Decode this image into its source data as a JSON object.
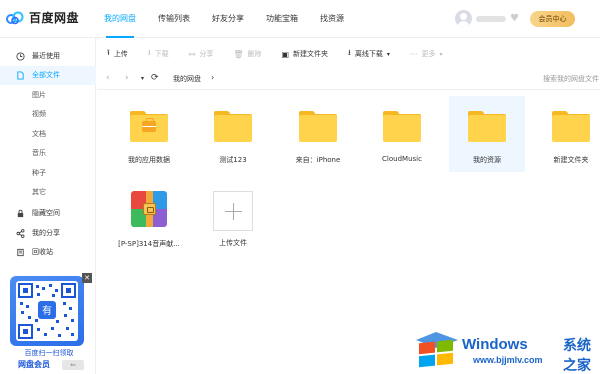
{
  "app": {
    "logo_text": "百度网盘"
  },
  "nav": {
    "tabs": [
      {
        "label": "我的网盘",
        "active": true
      },
      {
        "label": "传输列表"
      },
      {
        "label": "好友分享"
      },
      {
        "label": "功能宝箱"
      },
      {
        "label": "找资源"
      }
    ]
  },
  "user": {
    "vip_label": "会员中心"
  },
  "sidebar": {
    "items": [
      {
        "label": "最近使用",
        "icon": "clock-icon"
      },
      {
        "label": "全部文件",
        "icon": "file-icon",
        "active": true
      },
      {
        "label": "隐藏空间",
        "icon": "lock-icon"
      },
      {
        "label": "我的分享",
        "icon": "share-icon"
      },
      {
        "label": "回收站",
        "icon": "trash-icon"
      }
    ],
    "sub_items": [
      "图片",
      "视频",
      "文档",
      "音乐",
      "种子",
      "其它"
    ],
    "promo": {
      "line1": "百度扫一扫领取",
      "line2": "网盘会员"
    }
  },
  "toolbar": {
    "upload": "上传",
    "download": "下载",
    "share": "分享",
    "delete": "删除",
    "new_folder": "新建文件夹",
    "offline_download": "离线下载",
    "more": "更多"
  },
  "pathbar": {
    "breadcrumb": "我的网盘",
    "search_placeholder": "搜索我的网盘文件"
  },
  "files": [
    {
      "name": "我的应用数据",
      "type": "folder-app"
    },
    {
      "name": "测试123",
      "type": "folder"
    },
    {
      "name": "来自：iPhone",
      "type": "folder"
    },
    {
      "name": "CloudMusic",
      "type": "folder"
    },
    {
      "name": "我的资源",
      "type": "folder",
      "selected": true
    },
    {
      "name": "新建文件夹",
      "type": "folder"
    },
    {
      "name": "[P-SP]314音声献...",
      "type": "zip"
    },
    {
      "name": "上传文件",
      "type": "upload"
    }
  ],
  "watermark": {
    "title": "Windows",
    "subtitle": "系统之家",
    "url": "www.bjjmlv.com"
  },
  "colors": {
    "accent": "#06a7ff",
    "folder": "#ffd34c",
    "vip": "#f1bd5e"
  }
}
